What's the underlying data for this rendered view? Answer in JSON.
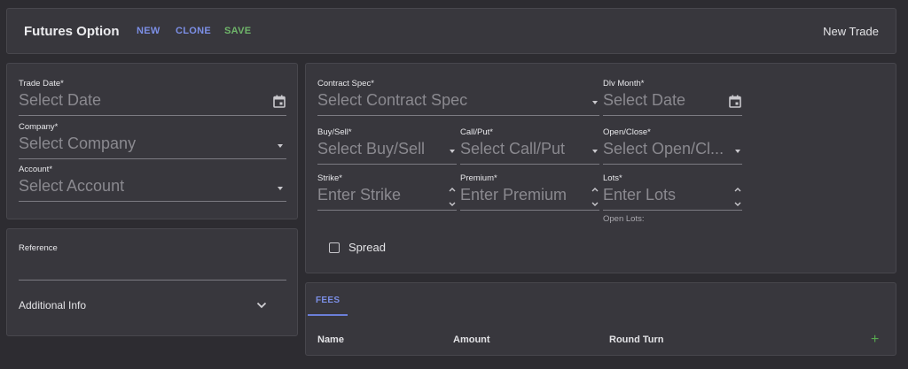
{
  "header": {
    "title": "Futures Option",
    "new_label": "NEW",
    "clone_label": "CLONE",
    "save_label": "SAVE",
    "right_label": "New Trade"
  },
  "trade_panel": {
    "trade_date": {
      "label": "Trade Date*",
      "placeholder": "Select Date",
      "icon": "calendar-icon"
    },
    "company": {
      "label": "Company*",
      "placeholder": "Select Company",
      "icon": "dropdown-arrow-icon"
    },
    "account": {
      "label": "Account*",
      "placeholder": "Select Account",
      "icon": "dropdown-arrow-icon"
    }
  },
  "reference_panel": {
    "reference_label": "Reference",
    "additional_info_label": "Additional Info",
    "icon": "chevron-down-icon"
  },
  "contract_panel": {
    "contract_spec": {
      "label": "Contract Spec*",
      "placeholder": "Select Contract Spec"
    },
    "dlv_month": {
      "label": "Dlv Month*",
      "placeholder": "Select Date"
    },
    "buy_sell": {
      "label": "Buy/Sell*",
      "placeholder": "Select Buy/Sell"
    },
    "call_put": {
      "label": "Call/Put*",
      "placeholder": "Select Call/Put"
    },
    "open_close": {
      "label": "Open/Close*",
      "placeholder": "Select Open/Cl..."
    },
    "strike": {
      "label": "Strike*",
      "placeholder": "Enter Strike"
    },
    "premium": {
      "label": "Premium*",
      "placeholder": "Enter Premium"
    },
    "lots": {
      "label": "Lots*",
      "placeholder": "Enter Lots",
      "helper": "Open Lots:"
    },
    "spread": {
      "label": "Spread",
      "checked": false
    }
  },
  "fees_panel": {
    "tab_label": "FEES",
    "columns": [
      "Name",
      "Amount",
      "Round Turn"
    ],
    "add_icon": "plus-icon"
  },
  "colors": {
    "background": "#2d2c31",
    "panel": "#38373d",
    "accent_blue": "#7c8fe6",
    "accent_green": "#6fb56a"
  }
}
